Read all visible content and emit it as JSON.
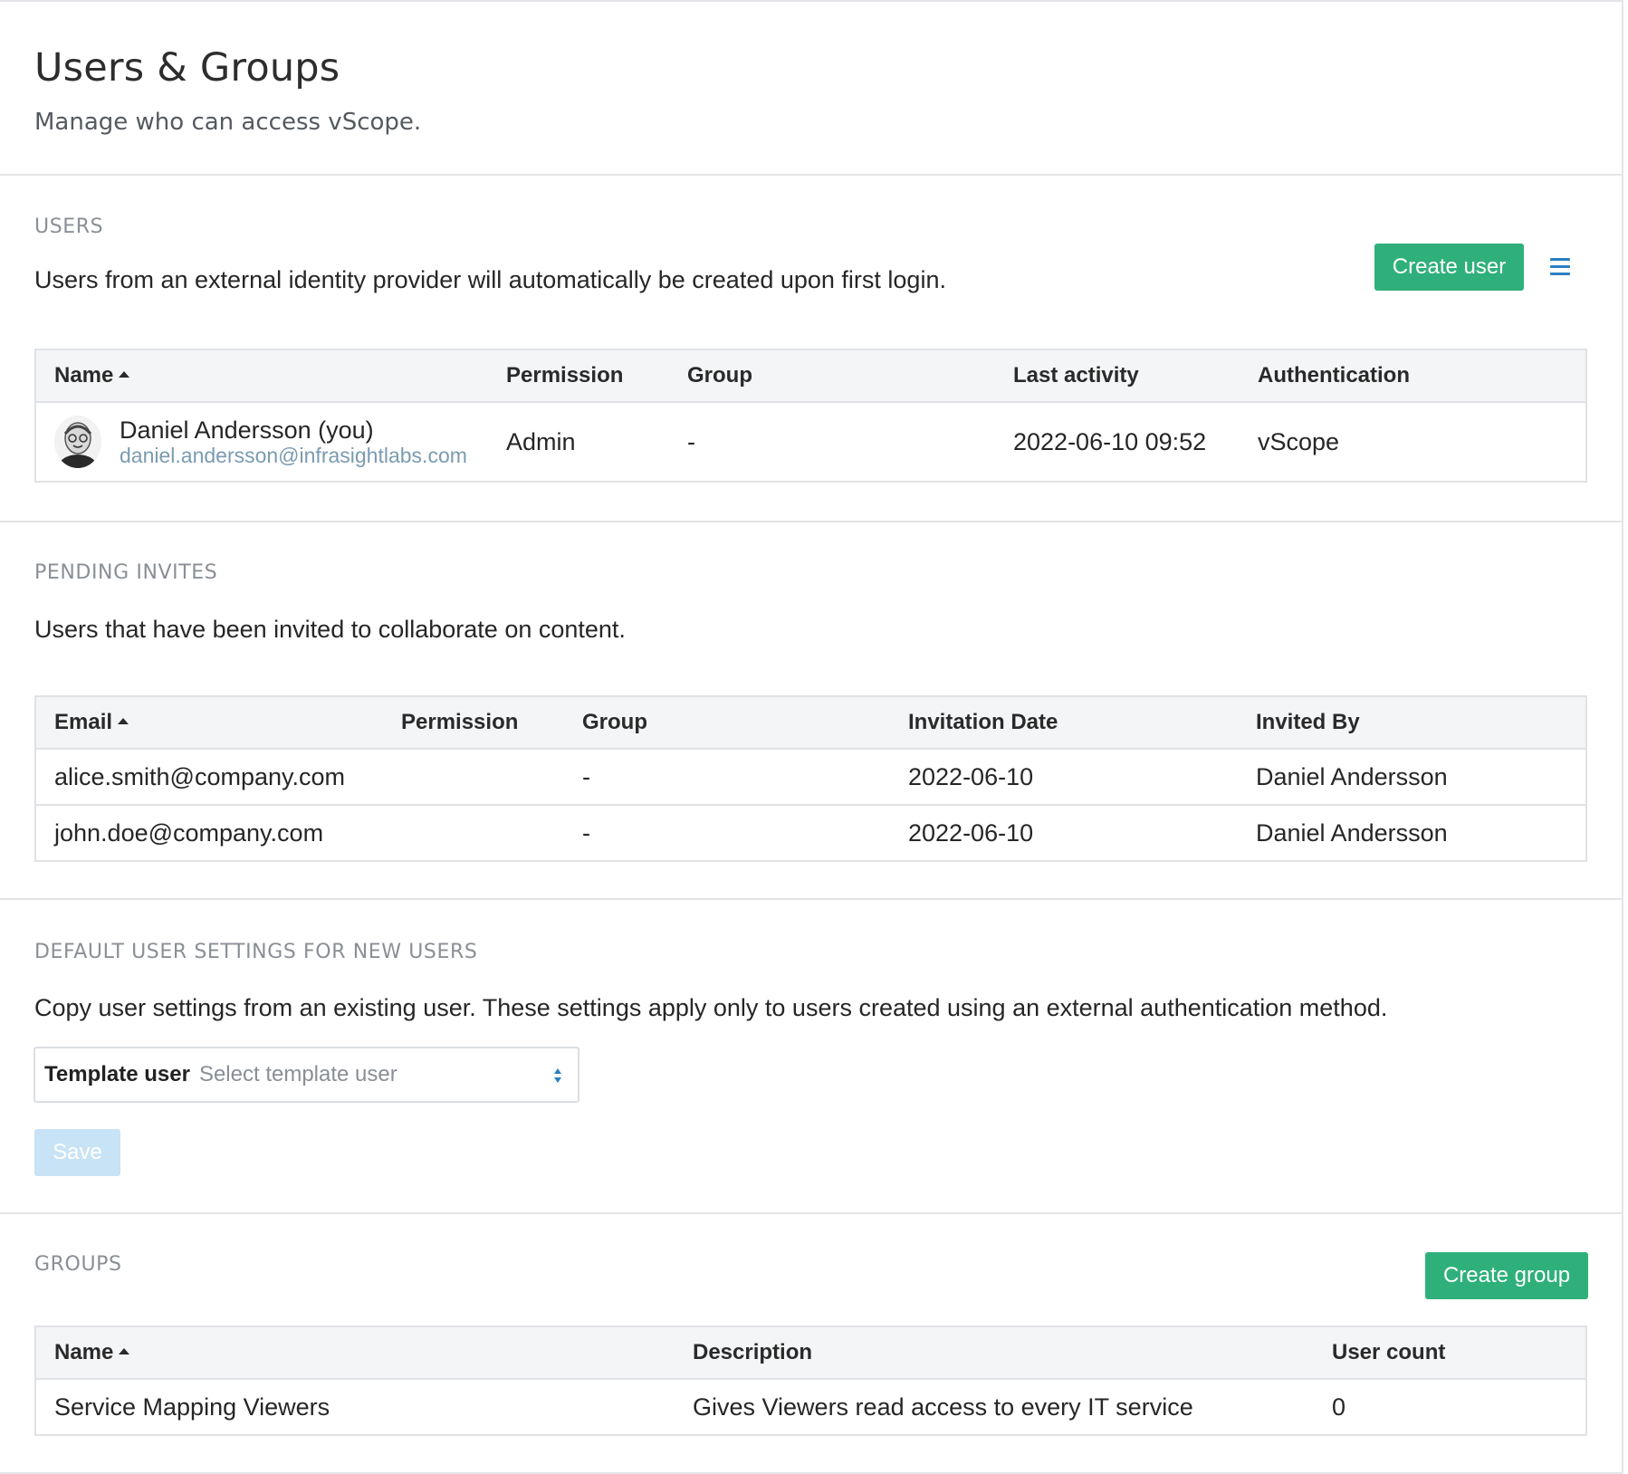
{
  "header": {
    "title": "Users & Groups",
    "subtitle": "Manage who can access vScope."
  },
  "users": {
    "label": "USERS",
    "description": "Users from an external identity provider will automatically be created upon first login.",
    "create_button": "Create user",
    "menu_icon": "hamburger-menu-icon",
    "columns": [
      "Name",
      "Permission",
      "Group",
      "Last activity",
      "Authentication"
    ],
    "rows": [
      {
        "name": "Daniel Andersson (you)",
        "email": "daniel.andersson@infrasightlabs.com",
        "permission": "Admin",
        "group": "-",
        "last_activity": "2022-06-10 09:52",
        "authentication": "vScope"
      }
    ]
  },
  "pending": {
    "label": "PENDING INVITES",
    "description": "Users that have been invited to collaborate on content.",
    "columns": [
      "Email",
      "Permission",
      "Group",
      "Invitation Date",
      "Invited By"
    ],
    "rows": [
      {
        "email": "alice.smith@company.com",
        "permission": "",
        "group": "-",
        "date": "2022-06-10",
        "invited_by": "Daniel Andersson"
      },
      {
        "email": "john.doe@company.com",
        "permission": "",
        "group": "-",
        "date": "2022-06-10",
        "invited_by": "Daniel Andersson"
      }
    ]
  },
  "defaults": {
    "label": "DEFAULT USER SETTINGS FOR NEW USERS",
    "description": "Copy user settings from an existing user. These settings apply only to users created using an external authentication method.",
    "template_label": "Template user",
    "template_placeholder": "Select template user",
    "save_button": "Save"
  },
  "groups": {
    "label": "GROUPS",
    "create_button": "Create group",
    "columns": [
      "Name",
      "Description",
      "User count"
    ],
    "rows": [
      {
        "name": "Service Mapping Viewers",
        "description": "Gives Viewers read access to every IT service",
        "user_count": "0"
      }
    ]
  },
  "colors": {
    "accent_green": "#2fb07a",
    "link_blue": "#2b7fc2",
    "save_disabled": "#c8e3f5",
    "email_muted": "#7a9bb0"
  }
}
